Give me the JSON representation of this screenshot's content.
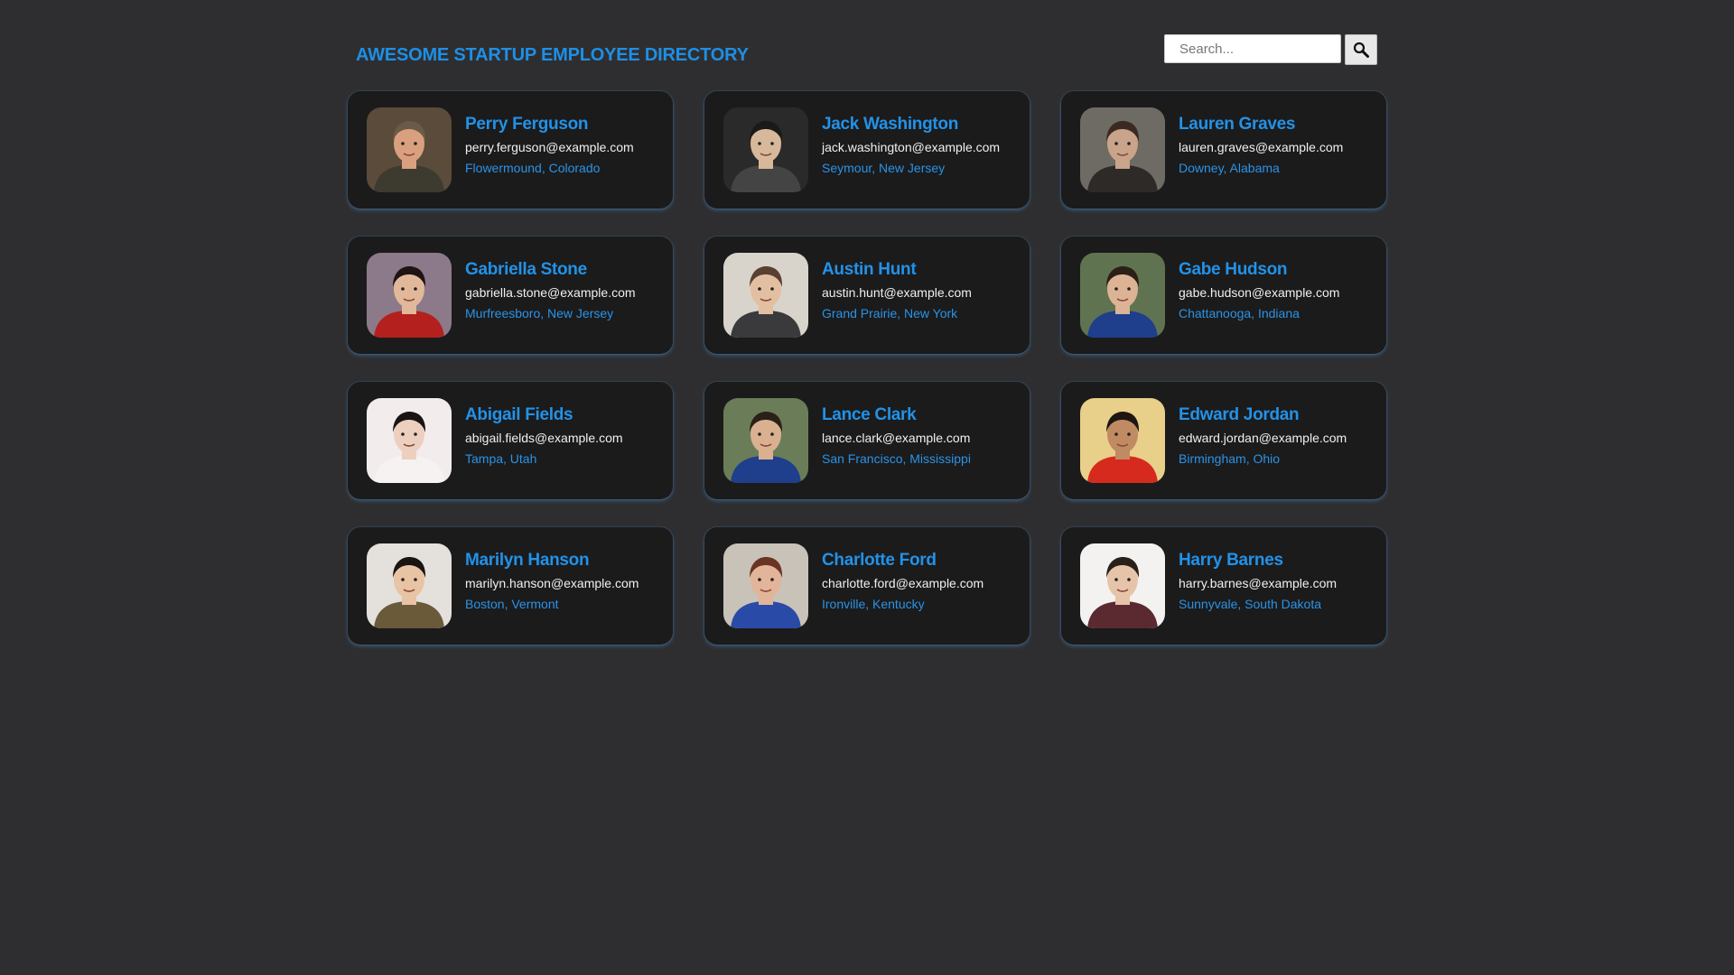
{
  "header": {
    "title": "AWESOME STARTUP EMPLOYEE DIRECTORY",
    "search_placeholder": "Search...",
    "search_icon": "magnifier-icon"
  },
  "colors": {
    "background": "#2e2e30",
    "card": "#1b1b1c",
    "accent": "#1e8fe6",
    "text": "#f0f0f0"
  },
  "employees": [
    {
      "name": "Perry Ferguson",
      "email": "perry.ferguson@example.com",
      "location": "Flowermound, Colorado",
      "photo": {
        "bg": "#5a4b3a",
        "skin": "#d9a07f",
        "hair": "#6b5a48",
        "shirt": "#3d3a30"
      }
    },
    {
      "name": "Jack Washington",
      "email": "jack.washington@example.com",
      "location": "Seymour, New Jersey",
      "photo": {
        "bg": "#2a2a2a",
        "skin": "#d8b89a",
        "hair": "#1a1a1a",
        "shirt": "#444444"
      }
    },
    {
      "name": "Lauren Graves",
      "email": "lauren.graves@example.com",
      "location": "Downey, Alabama",
      "photo": {
        "bg": "#6e6a64",
        "skin": "#c9a38a",
        "hair": "#3b2a22",
        "shirt": "#2e2a28"
      }
    },
    {
      "name": "Gabriella Stone",
      "email": "gabriella.stone@example.com",
      "location": "Murfreesboro, New Jersey",
      "photo": {
        "bg": "#8c7a8a",
        "skin": "#e2b89a",
        "hair": "#1e1414",
        "shirt": "#b3201e"
      }
    },
    {
      "name": "Austin Hunt",
      "email": "austin.hunt@example.com",
      "location": "Grand Prairie, New York",
      "photo": {
        "bg": "#d8d4cc",
        "skin": "#e3bfa2",
        "hair": "#5a4030",
        "shirt": "#3a3a3c"
      }
    },
    {
      "name": "Gabe Hudson",
      "email": "gabe.hudson@example.com",
      "location": "Chattanooga, Indiana",
      "photo": {
        "bg": "#5f7350",
        "skin": "#dcb394",
        "hair": "#2b2018",
        "shirt": "#1f3e8c"
      }
    },
    {
      "name": "Abigail Fields",
      "email": "abigail.fields@example.com",
      "location": "Tampa, Utah",
      "photo": {
        "bg": "#f2ecec",
        "skin": "#edcfbf",
        "hair": "#1a1414",
        "shirt": "#f7f2f2"
      }
    },
    {
      "name": "Lance Clark",
      "email": "lance.clark@example.com",
      "location": "San Francisco, Mississippi",
      "photo": {
        "bg": "#6b7d58",
        "skin": "#d9b090",
        "hair": "#2b2018",
        "shirt": "#1f3e8c"
      }
    },
    {
      "name": "Edward Jordan",
      "email": "edward.jordan@example.com",
      "location": "Birmingham, Ohio",
      "photo": {
        "bg": "#e8cf8a",
        "skin": "#c08a62",
        "hair": "#1e1612",
        "shirt": "#d62a1e"
      }
    },
    {
      "name": "Marilyn Hanson",
      "email": "marilyn.hanson@example.com",
      "location": "Boston, Vermont",
      "photo": {
        "bg": "#e4e0dc",
        "skin": "#e8c3a4",
        "hair": "#1a1412",
        "shirt": "#6a5a3a"
      }
    },
    {
      "name": "Charlotte Ford",
      "email": "charlotte.ford@example.com",
      "location": "Ironville, Kentucky",
      "photo": {
        "bg": "#c9c2b8",
        "skin": "#e2b49a",
        "hair": "#6a3424",
        "shirt": "#2a4aa8"
      }
    },
    {
      "name": "Harry Barnes",
      "email": "harry.barnes@example.com",
      "location": "Sunnyvale, South Dakota",
      "photo": {
        "bg": "#f4f2f0",
        "skin": "#e6c4aa",
        "hair": "#2a201a",
        "shirt": "#5a2a30"
      }
    }
  ]
}
